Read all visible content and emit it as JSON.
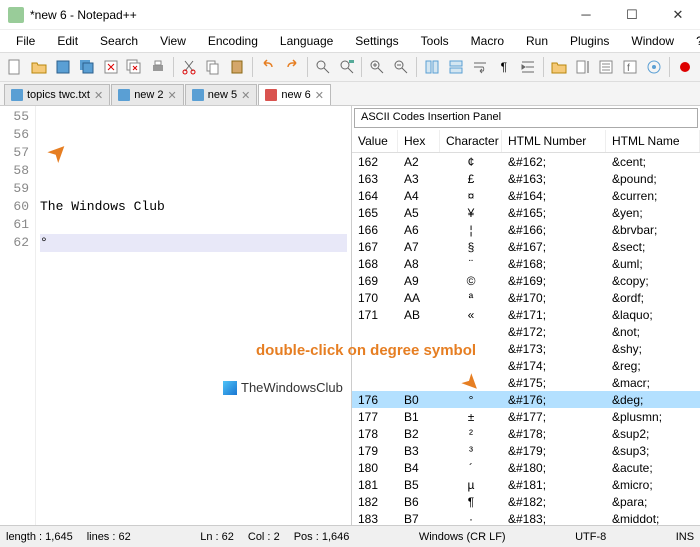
{
  "titlebar": {
    "title": "*new 6 - Notepad++"
  },
  "menu": [
    "File",
    "Edit",
    "Search",
    "View",
    "Encoding",
    "Language",
    "Settings",
    "Tools",
    "Macro",
    "Run",
    "Plugins",
    "Window",
    "?"
  ],
  "tabs": [
    {
      "label": "topics twc.txt",
      "active": false
    },
    {
      "label": "new 2",
      "active": false
    },
    {
      "label": "new 5",
      "active": false
    },
    {
      "label": "new 6",
      "active": true
    }
  ],
  "editor": {
    "lines": [
      "55",
      "56",
      "57",
      "58",
      "59",
      "60",
      "61",
      "62"
    ],
    "content": [
      "",
      "",
      "",
      "",
      "",
      "The Windows Club",
      "",
      "°"
    ],
    "current_line": 7
  },
  "watermark": {
    "text": "TheWindowsClub"
  },
  "panel": {
    "title": "ASCII Codes Insertion Panel",
    "headers": [
      "Value",
      "Hex",
      "Character",
      "HTML Number",
      "HTML Name"
    ],
    "highlight_index": 14,
    "rows": [
      {
        "v": "162",
        "h": "A2",
        "c": "¢",
        "n": "&#162;",
        "m": "&cent;"
      },
      {
        "v": "163",
        "h": "A3",
        "c": "£",
        "n": "&#163;",
        "m": "&pound;"
      },
      {
        "v": "164",
        "h": "A4",
        "c": "¤",
        "n": "&#164;",
        "m": "&curren;"
      },
      {
        "v": "165",
        "h": "A5",
        "c": "¥",
        "n": "&#165;",
        "m": "&yen;"
      },
      {
        "v": "166",
        "h": "A6",
        "c": "¦",
        "n": "&#166;",
        "m": "&brvbar;"
      },
      {
        "v": "167",
        "h": "A7",
        "c": "§",
        "n": "&#167;",
        "m": "&sect;"
      },
      {
        "v": "168",
        "h": "A8",
        "c": "¨",
        "n": "&#168;",
        "m": "&uml;"
      },
      {
        "v": "169",
        "h": "A9",
        "c": "©",
        "n": "&#169;",
        "m": "&copy;"
      },
      {
        "v": "170",
        "h": "AA",
        "c": "ª",
        "n": "&#170;",
        "m": "&ordf;"
      },
      {
        "v": "171",
        "h": "AB",
        "c": "«",
        "n": "&#171;",
        "m": "&laquo;"
      },
      {
        "v": "",
        "h": "",
        "c": "",
        "n": "&#172;",
        "m": "&not;"
      },
      {
        "v": "",
        "h": "",
        "c": "",
        "n": "&#173;",
        "m": "&shy;"
      },
      {
        "v": "",
        "h": "",
        "c": "",
        "n": "&#174;",
        "m": "&reg;"
      },
      {
        "v": "",
        "h": "",
        "c": "",
        "n": "&#175;",
        "m": "&macr;"
      },
      {
        "v": "176",
        "h": "B0",
        "c": "°",
        "n": "&#176;",
        "m": "&deg;"
      },
      {
        "v": "177",
        "h": "B1",
        "c": "±",
        "n": "&#177;",
        "m": "&plusmn;"
      },
      {
        "v": "178",
        "h": "B2",
        "c": "²",
        "n": "&#178;",
        "m": "&sup2;"
      },
      {
        "v": "179",
        "h": "B3",
        "c": "³",
        "n": "&#179;",
        "m": "&sup3;"
      },
      {
        "v": "180",
        "h": "B4",
        "c": "´",
        "n": "&#180;",
        "m": "&acute;"
      },
      {
        "v": "181",
        "h": "B5",
        "c": "µ",
        "n": "&#181;",
        "m": "&micro;"
      },
      {
        "v": "182",
        "h": "B6",
        "c": "¶",
        "n": "&#182;",
        "m": "&para;"
      },
      {
        "v": "183",
        "h": "B7",
        "c": "·",
        "n": "&#183;",
        "m": "&middot;"
      }
    ]
  },
  "annotation": {
    "text": "double-click on degree symbol"
  },
  "status": {
    "length_label": "length :",
    "length": "1,645",
    "lines_label": "lines :",
    "lines": "62",
    "ln_label": "Ln :",
    "ln": "62",
    "col_label": "Col :",
    "col": "2",
    "pos_label": "Pos :",
    "pos": "1,646",
    "eol": "Windows (CR LF)",
    "encoding": "UTF-8",
    "mode": "INS"
  }
}
